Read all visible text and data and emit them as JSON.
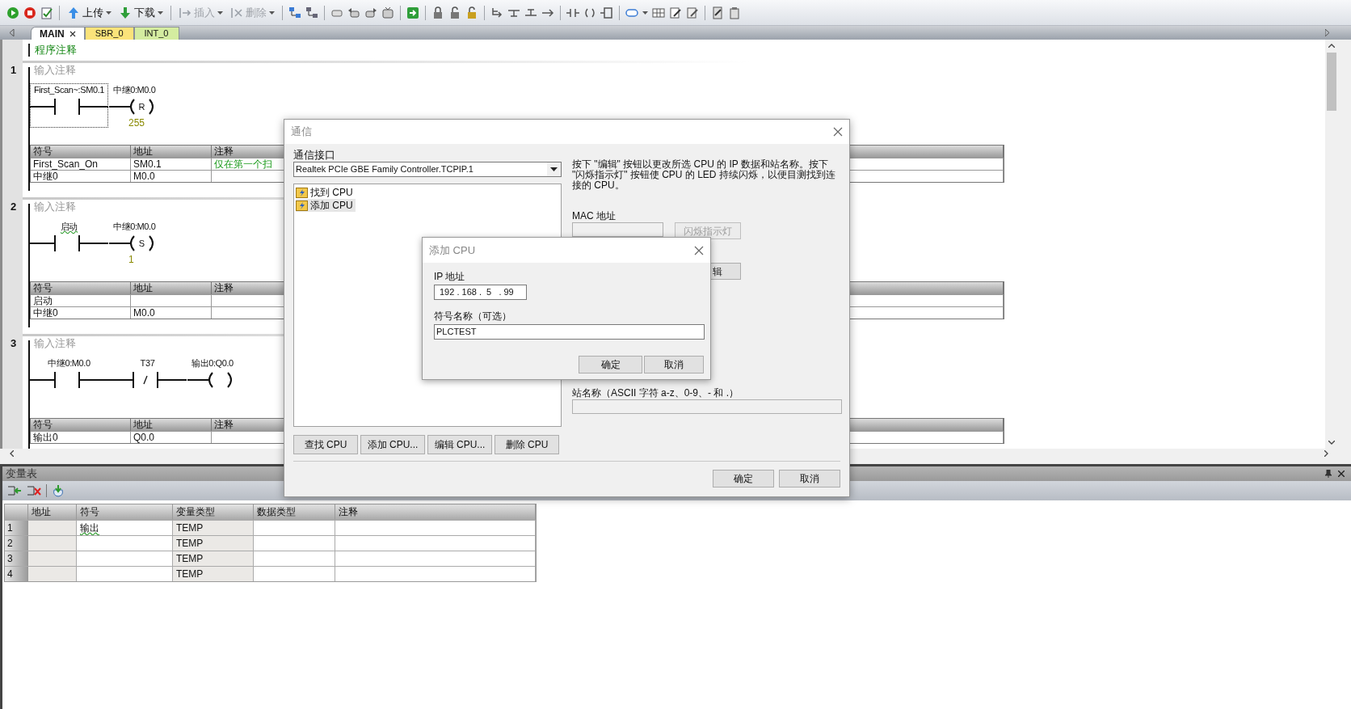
{
  "toolbar": {
    "buttons": [
      {
        "kind": "upload",
        "label": "上传",
        "disabled": false
      },
      {
        "kind": "download",
        "label": "下载",
        "disabled": false
      },
      {
        "kind": "insert",
        "label": "插入",
        "disabled": true
      },
      {
        "kind": "delete",
        "label": "删除",
        "disabled": true
      }
    ]
  },
  "tabs": [
    {
      "label": "MAIN",
      "selected": true,
      "color": "#ffffff"
    },
    {
      "label": "SBR_0",
      "selected": false,
      "color": "#fbe37a"
    },
    {
      "label": "INT_0",
      "selected": false,
      "color": "#d4eca0"
    }
  ],
  "editor": {
    "program_comment": "程序注释",
    "networks": [
      {
        "number": "1",
        "comment": "输入注释",
        "elements": [
          {
            "kind": "contact",
            "label": "First_Scan~:SM0.1",
            "selected": true,
            "warning": false
          },
          {
            "kind": "coil",
            "label": "中继0:M0.0",
            "op": "R",
            "value": "255",
            "selected": false,
            "warning": false
          }
        ],
        "symbol_columns": [
          "符号",
          "地址",
          "注释"
        ],
        "symbols": [
          {
            "symbol": "First_Scan_On",
            "address": "SM0.1",
            "comment": "仅在第一个扫"
          },
          {
            "symbol": "中继0",
            "address": "M0.0"
          }
        ]
      },
      {
        "number": "2",
        "comment": "输入注释",
        "elements": [
          {
            "kind": "contact",
            "label": "启动",
            "selected": false,
            "warning": true
          },
          {
            "kind": "coil",
            "label": "中继0:M0.0",
            "op": "S",
            "value": "1",
            "selected": false,
            "warning": false
          }
        ],
        "symbol_columns": [
          "符号",
          "地址",
          "注释"
        ],
        "symbols": [
          {
            "symbol": "启动"
          },
          {
            "symbol": "中继0",
            "address": "M0.0"
          }
        ]
      },
      {
        "number": "3",
        "comment": "输入注释",
        "elements": [
          {
            "kind": "contact",
            "label": "中继0:M0.0",
            "selected": false,
            "warning": false
          },
          {
            "kind": "contact_nc",
            "label": "T37",
            "selected": false,
            "warning": false
          },
          {
            "kind": "coil",
            "label": "输出0:Q0.0",
            "selected": false,
            "warning": false
          }
        ],
        "symbol_columns": [
          "符号",
          "地址",
          "注释"
        ],
        "symbols": [
          {
            "symbol": "输出0",
            "address": "Q0.0"
          }
        ]
      }
    ]
  },
  "variable_table": {
    "title": "变量表",
    "columns": [
      "地址",
      "符号",
      "变量类型",
      "数据类型",
      "注释"
    ],
    "rows": [
      {
        "number": "1",
        "symbol": "输出",
        "symbol_warning": true,
        "var_type": "TEMP"
      },
      {
        "number": "2",
        "var_type": "TEMP"
      },
      {
        "number": "3",
        "var_type": "TEMP"
      },
      {
        "number": "4",
        "var_type": "TEMP"
      }
    ]
  },
  "comm_dialog": {
    "title": "通信",
    "interface_label": "通信接口",
    "interface": "Realtek PCIe GBE Family Controller.TCPIP.1",
    "cpus": [
      {
        "label": "找到 CPU",
        "selected": false
      },
      {
        "label": "添加 CPU",
        "selected": true
      }
    ],
    "list_buttons": [
      "查找 CPU",
      "添加 CPU...",
      "编辑 CPU...",
      "删除 CPU"
    ],
    "description": "按下 \"编辑\" 按钮以更改所选 CPU 的 IP 数据和站名称。按下 \"闪烁指示灯\" 按钮使 CPU 的 LED 持续闪烁，以便目测找到连接的 CPU。",
    "mac_label": "MAC 地址",
    "blink_button": {
      "label": "闪烁指示灯",
      "disabled": true
    },
    "edit_button": {
      "label": "辑",
      "disabled": false
    },
    "station_label": "站名称（ASCII 字符 a-z、0-9、- 和 .）",
    "ok": "确定",
    "cancel": "取消"
  },
  "add_cpu_dialog": {
    "title": "添加 CPU",
    "ip_label": "IP 地址",
    "ip": "192 . 168 .  5   . 99",
    "name_label": "符号名称（可选）",
    "name": "PLCTEST",
    "ok": "确定",
    "cancel": "取消"
  }
}
